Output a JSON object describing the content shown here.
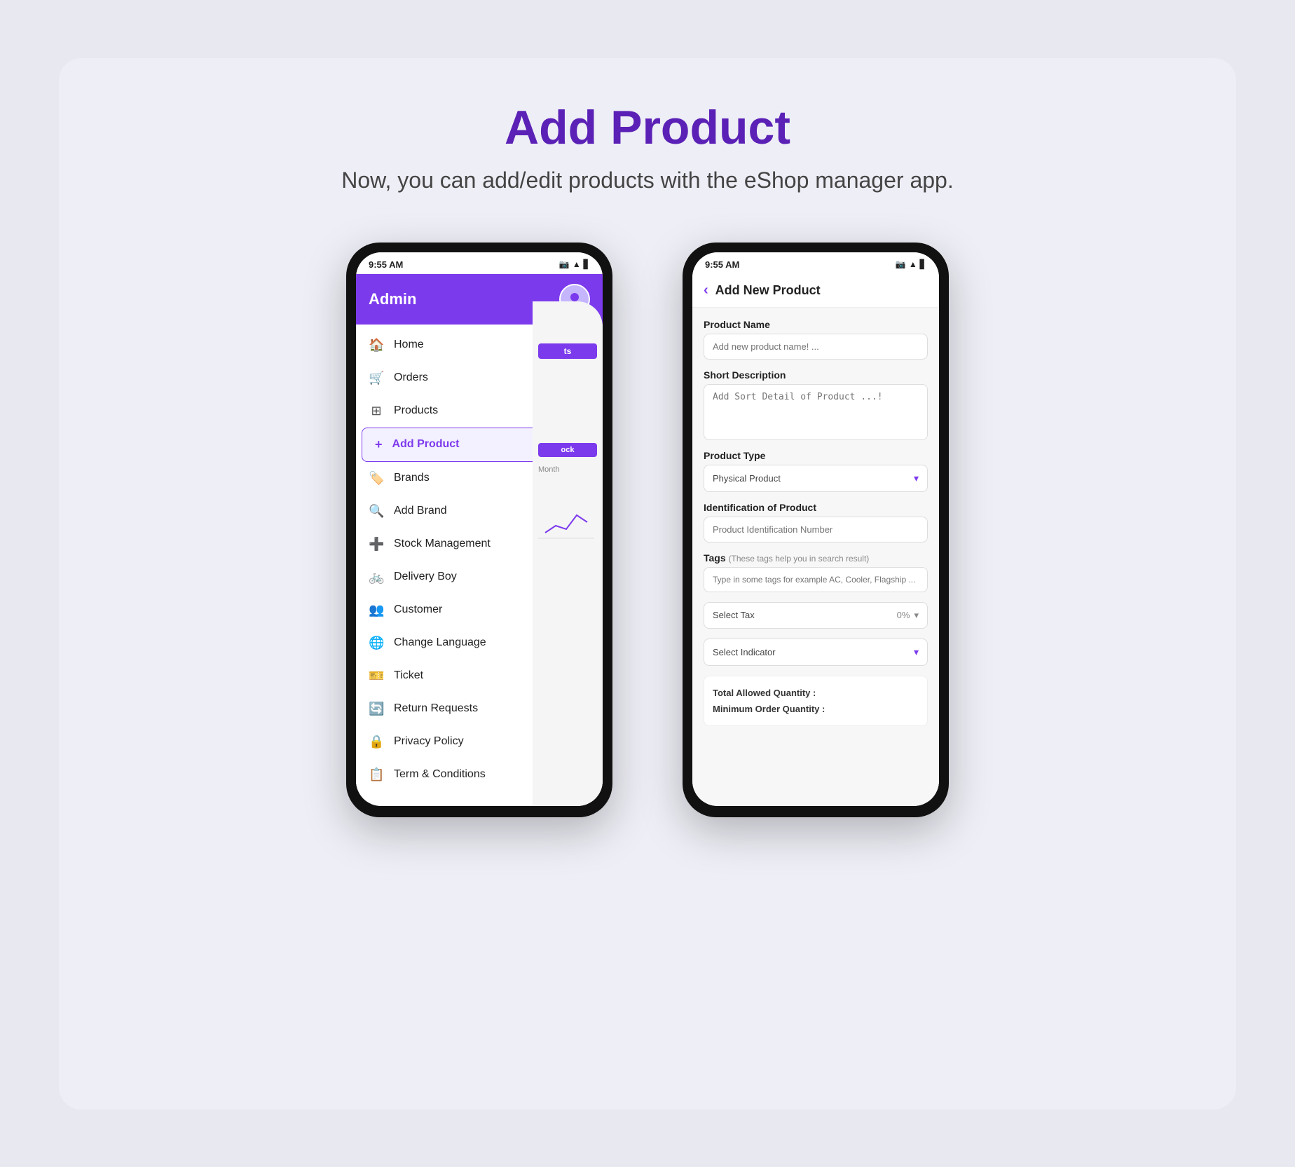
{
  "page": {
    "title": "Add Product",
    "subtitle": "Now, you can add/edit products with the eShop manager app."
  },
  "phone_left": {
    "status_bar": {
      "time": "9:55 AM",
      "icons": [
        "📷",
        "WiFi",
        "🔋"
      ]
    },
    "header": {
      "title": "Admin",
      "avatar_icon": "👤"
    },
    "menu": [
      {
        "label": "Home",
        "icon": "🏠",
        "active": false
      },
      {
        "label": "Orders",
        "icon": "🛒",
        "active": false
      },
      {
        "label": "Products",
        "icon": "⊞",
        "active": false
      },
      {
        "label": "Add Product",
        "icon": "+",
        "active": true
      },
      {
        "label": "Brands",
        "icon": "🏷️",
        "active": false
      },
      {
        "label": "Add Brand",
        "icon": "🔍",
        "active": false
      },
      {
        "label": "Stock Management",
        "icon": "➕",
        "active": false
      },
      {
        "label": "Delivery Boy",
        "icon": "🚲",
        "active": false
      },
      {
        "label": "Customer",
        "icon": "👥",
        "active": false
      },
      {
        "label": "Change Language",
        "icon": "🌐",
        "active": false
      },
      {
        "label": "Ticket",
        "icon": "🎫",
        "active": false
      },
      {
        "label": "Return Requests",
        "icon": "🔄",
        "active": false
      },
      {
        "label": "Privacy Policy",
        "icon": "🔒",
        "active": false
      },
      {
        "label": "Term & Conditions",
        "icon": "📋",
        "active": false
      }
    ]
  },
  "phone_right": {
    "status_bar": {
      "time": "9:55 AM",
      "icons": [
        "📷",
        "WiFi",
        "🔋"
      ]
    },
    "form": {
      "header_back": "‹",
      "header_title": "Add New Product",
      "fields": [
        {
          "label": "Product Name",
          "type": "input",
          "placeholder": "Add new product name! ..."
        },
        {
          "label": "Short Description",
          "type": "textarea",
          "placeholder": "Add Sort Detail of Product ...!"
        },
        {
          "label": "Product Type",
          "type": "select",
          "value": "Physical Product",
          "placeholder": ""
        },
        {
          "label": "Identification of Product",
          "type": "input",
          "placeholder": "Product Identification Number"
        },
        {
          "label": "Tags",
          "label_note": "  (These tags help you in search result)",
          "type": "tags",
          "placeholder": "Type in some tags for example AC, Cooler, Flagship ..."
        },
        {
          "label": "",
          "type": "select-tax",
          "value": "Select Tax",
          "right_value": "0%"
        },
        {
          "label": "",
          "type": "select",
          "value": "Select Indicator",
          "placeholder": ""
        }
      ],
      "quantity_fields": [
        {
          "label": "Total Allowed Quantity :"
        },
        {
          "label": "Minimum Order Quantity :"
        }
      ]
    }
  }
}
